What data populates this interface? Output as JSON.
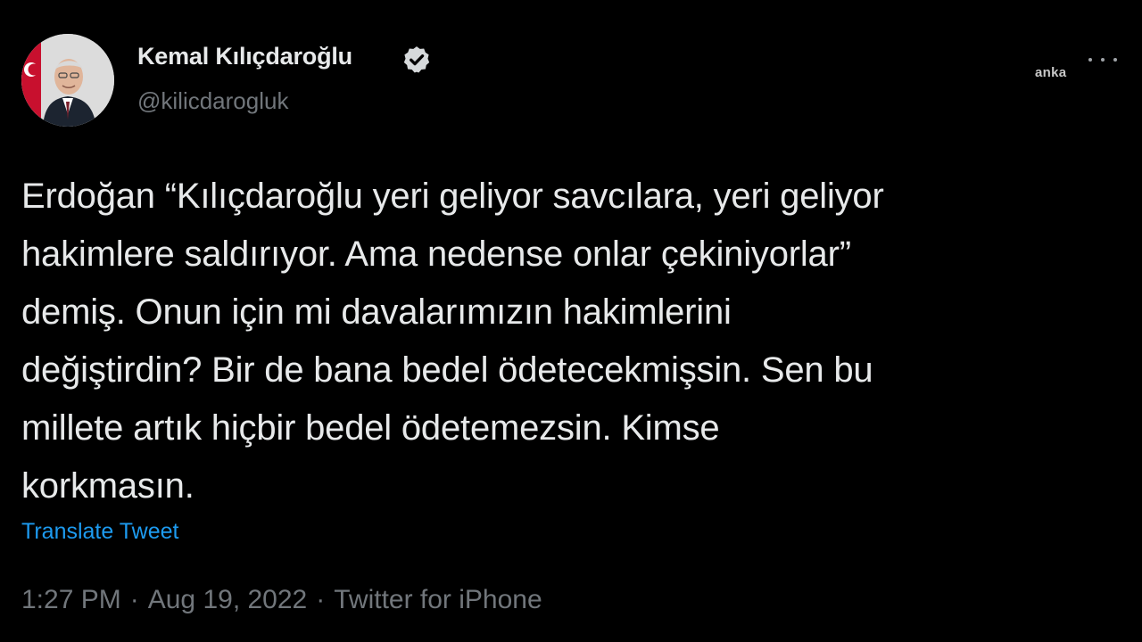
{
  "author": {
    "name": "Kemal Kılıçdaroğlu",
    "handle": "@kilicdarogluk",
    "verified_icon": "verified-badge-icon",
    "avatar_icon": "profile-photo"
  },
  "watermark": "anka",
  "tweet": {
    "lines": [
      "Erdoğan “Kılıçdaroğlu yeri geliyor savcılara, yeri geliyor",
      "hakimlere saldırıyor. Ama nedense onlar çekiniyorlar”",
      "demiş. Onun için mi davalarımızın hakimlerini",
      "değiştirdin? Bir de bana bedel ödetecekmişsin. Sen bu",
      "millete artık hiçbir bedel ödetemezsin. Kimse",
      "korkmasın."
    ],
    "translate_label": "Translate Tweet"
  },
  "meta": {
    "time": "1:27 PM",
    "date": "Aug 19, 2022",
    "source": "Twitter for iPhone",
    "separator": "·"
  },
  "colors": {
    "background": "#000000",
    "text": "#e7e9ea",
    "secondary": "#71767b",
    "link": "#1d9bf0"
  }
}
